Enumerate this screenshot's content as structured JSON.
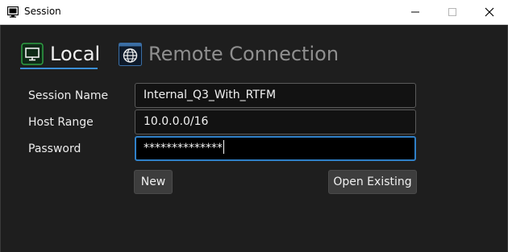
{
  "window": {
    "title": "Session",
    "minimize_symbol": "—",
    "maximize_symbol": "☐",
    "close_symbol": "✕"
  },
  "tabs": [
    {
      "label": "Local",
      "icon": "monitor-icon",
      "selected": true
    },
    {
      "label": "Remote Connection",
      "icon": "globe-icon",
      "selected": false
    }
  ],
  "form": {
    "session_name": {
      "label": "Session Name",
      "value": "Internal_Q3_With_RTFM"
    },
    "host_range": {
      "label": "Host Range",
      "value": "10.0.0.0/16"
    },
    "password": {
      "label": "Password",
      "value": "**************"
    }
  },
  "buttons": {
    "new_label": "New",
    "open_existing_label": "Open Existing"
  },
  "colors": {
    "accent": "#3b8fd6",
    "background": "#1e1e1e",
    "local_icon_accent": "#2ea043",
    "focused_border": "#2f80c8"
  }
}
